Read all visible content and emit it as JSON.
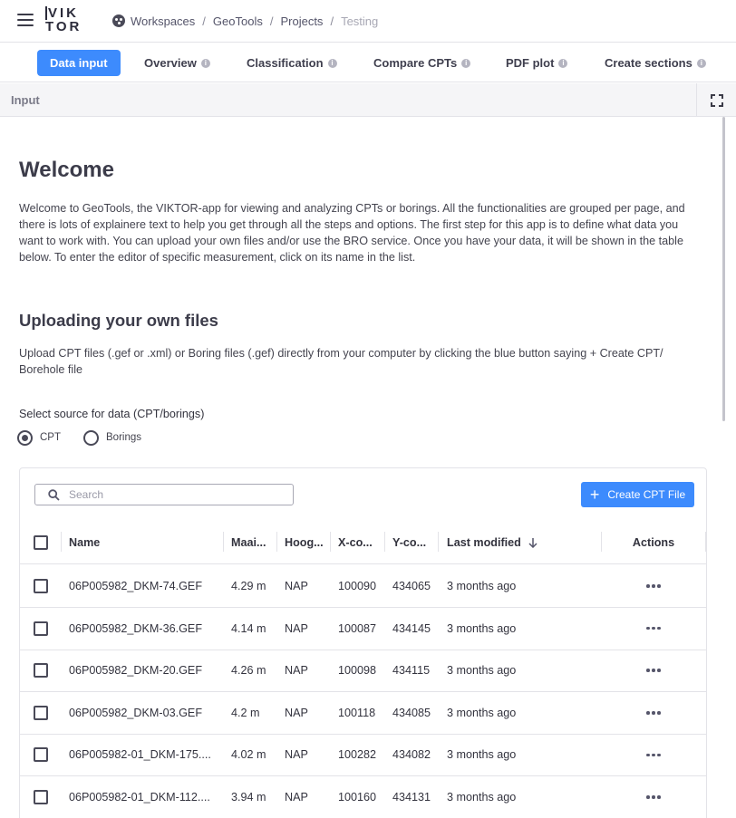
{
  "header": {
    "logo_line1": "VIK",
    "logo_line2": "TOR",
    "breadcrumb": [
      "Workspaces",
      "GeoTools",
      "Projects",
      "Testing"
    ]
  },
  "tabs": [
    {
      "label": "Data input",
      "active": true
    },
    {
      "label": "Overview",
      "active": false
    },
    {
      "label": "Classification",
      "active": false
    },
    {
      "label": "Compare CPTs",
      "active": false
    },
    {
      "label": "PDF plot",
      "active": false
    },
    {
      "label": "Create sections",
      "active": false
    }
  ],
  "input_panel": {
    "label": "Input"
  },
  "content": {
    "title": "Welcome",
    "intro": "Welcome to GeoTools, the VIKTOR-app for viewing and analyzing CPTs or borings. All the functionalities are grouped per page, and there is lots of explainere text to help you get through all the steps and options. The first step for this app is to define what data you want to work with. You can upload your own files and/or use the BRO service. Once you have your data, it will be shown in the table below. To enter the editor of specific measurement, click on its name in the list.",
    "upload_heading": "Uploading your own files",
    "upload_text": "Upload CPT files (.gef or .xml) or Boring files (.gef) directly from your computer by clicking the blue button saying + Create CPT/ Borehole file",
    "source_label": "Select source for data (CPT/borings)",
    "source_options": [
      "CPT",
      "Borings"
    ],
    "source_selected": "CPT"
  },
  "table": {
    "search_placeholder": "Search",
    "create_button": "Create CPT File",
    "columns": [
      "Name",
      "Maai...",
      "Hoog...",
      "X-co...",
      "Y-co...",
      "Last modified",
      "Actions"
    ],
    "sort_column": "Last modified",
    "sort_direction": "descending",
    "rows": [
      {
        "name": "06P005982_DKM-74.GEF",
        "maai": "4.29 m",
        "hoog": "NAP",
        "x": "100090",
        "y": "434065",
        "modified": "3 months ago"
      },
      {
        "name": "06P005982_DKM-36.GEF",
        "maai": "4.14 m",
        "hoog": "NAP",
        "x": "100087",
        "y": "434145",
        "modified": "3 months ago"
      },
      {
        "name": "06P005982_DKM-20.GEF",
        "maai": "4.26 m",
        "hoog": "NAP",
        "x": "100098",
        "y": "434115",
        "modified": "3 months ago"
      },
      {
        "name": "06P005982_DKM-03.GEF",
        "maai": "4.2 m",
        "hoog": "NAP",
        "x": "100118",
        "y": "434085",
        "modified": "3 months ago"
      },
      {
        "name": "06P005982-01_DKM-175....",
        "maai": "4.02 m",
        "hoog": "NAP",
        "x": "100282",
        "y": "434082",
        "modified": "3 months ago"
      },
      {
        "name": "06P005982-01_DKM-112....",
        "maai": "3.94 m",
        "hoog": "NAP",
        "x": "100160",
        "y": "434131",
        "modified": "3 months ago"
      }
    ]
  },
  "colors": {
    "accent": "#3d8bfd",
    "border": "#e3e3e8",
    "text": "#33333e"
  }
}
